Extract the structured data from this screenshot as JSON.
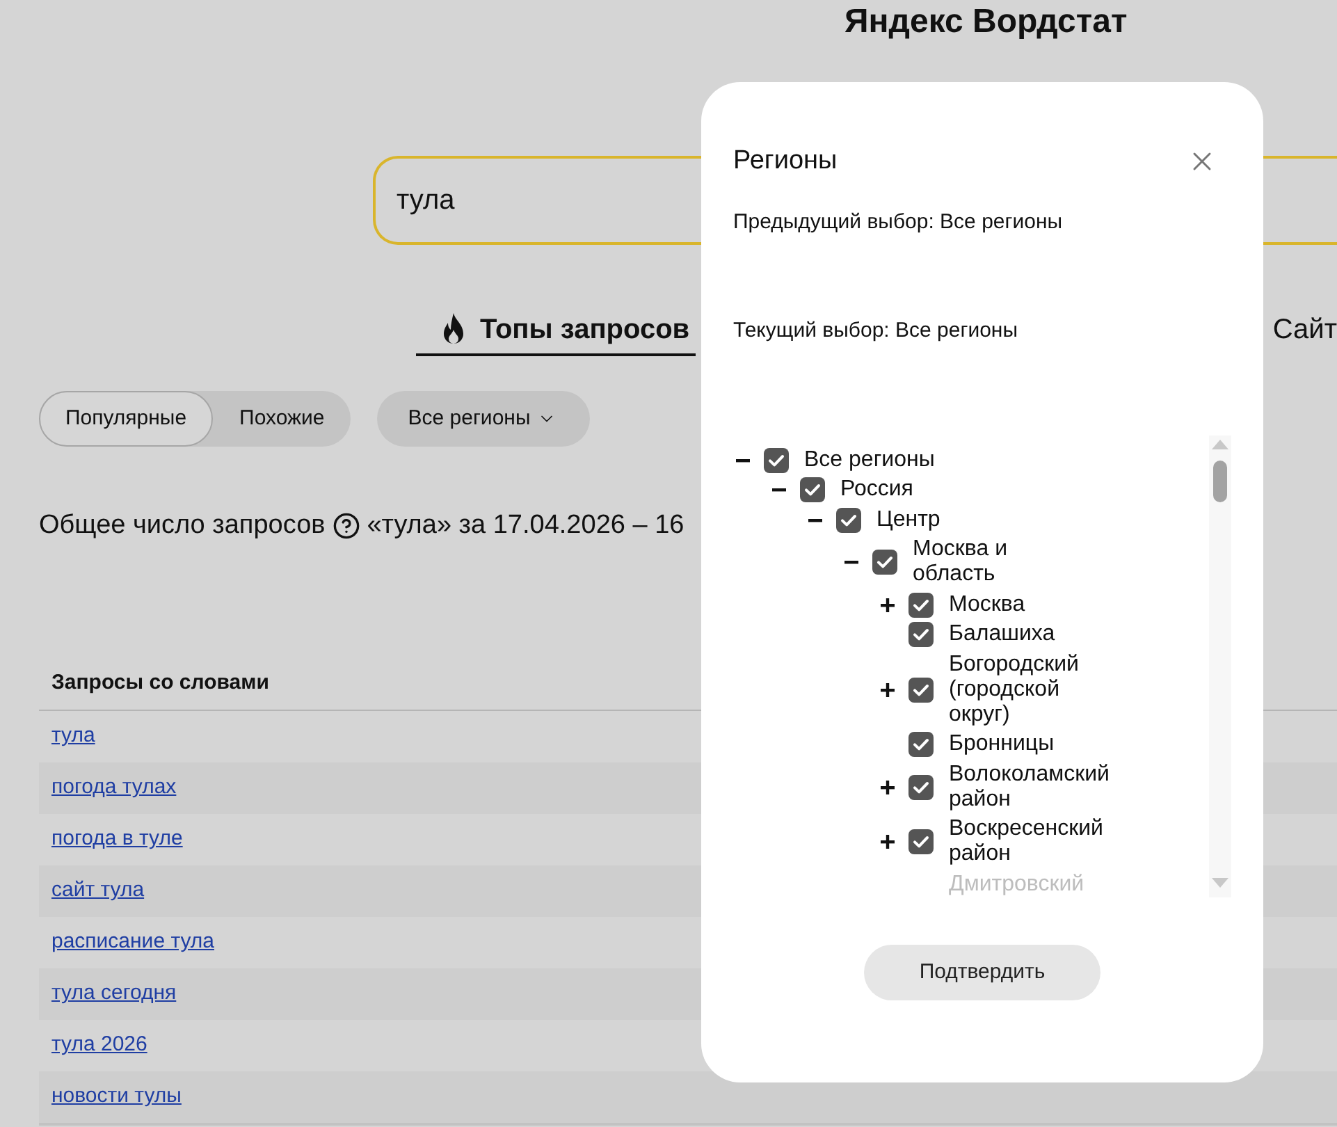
{
  "header": {
    "title": "Яндекс Вордстат"
  },
  "search": {
    "value": "тула"
  },
  "tabs": [
    {
      "label": "Топы запросов",
      "kind": "hot",
      "selected": true
    },
    {
      "label": "Сайт",
      "kind": "plain",
      "selected": false
    }
  ],
  "filters": {
    "modes": [
      {
        "label": "Популярные",
        "selected": true
      },
      {
        "label": "Похожие",
        "selected": false
      }
    ],
    "region": "Все регионы"
  },
  "summary": {
    "label": "Общее число запросов",
    "query_period": "«тула» за 17.04.2026 – 16"
  },
  "table": {
    "columns": [
      "Запросы со словами"
    ],
    "rows": [
      {
        "query": "тула"
      },
      {
        "query": "погода тулах"
      },
      {
        "query": "погода в туле"
      },
      {
        "query": "сайт тула"
      },
      {
        "query": "расписание тула"
      },
      {
        "query": "тула сегодня"
      },
      {
        "query": "тула 2026"
      },
      {
        "query": "новости тулы"
      }
    ]
  },
  "modal": {
    "title": "Регионы",
    "previous": "Предыдущий выбор: Все регионы",
    "current": "Текущий выбор: Все регионы",
    "tree": [
      {
        "label": "Все регионы",
        "kind": "group",
        "expanded": true,
        "checked": true,
        "children": [
          {
            "label": "Россия",
            "kind": "group",
            "expanded": true,
            "checked": true,
            "children": [
              {
                "label": "Центр",
                "kind": "group",
                "expanded": true,
                "checked": true,
                "children": [
                  {
                    "label": "Москва и область",
                    "kind": "group",
                    "expanded": true,
                    "checked": true,
                    "children": [
                      {
                        "label": "Москва",
                        "kind": "group",
                        "expanded": false,
                        "checked": true
                      },
                      {
                        "label": "Балашиха",
                        "kind": "leaf",
                        "checked": true
                      },
                      {
                        "label": "Богородский (городской округ)",
                        "kind": "group",
                        "expanded": false,
                        "checked": true
                      },
                      {
                        "label": "Бронницы",
                        "kind": "leaf",
                        "checked": true
                      },
                      {
                        "label": "Волоколамский район",
                        "kind": "group",
                        "expanded": false,
                        "checked": true
                      },
                      {
                        "label": "Воскресенский район",
                        "kind": "group",
                        "expanded": false,
                        "checked": true
                      },
                      {
                        "label": "Дмитровский",
                        "kind": "partial"
                      }
                    ]
                  }
                ]
              }
            ]
          }
        ]
      }
    ],
    "confirm": "Подтвердить"
  }
}
